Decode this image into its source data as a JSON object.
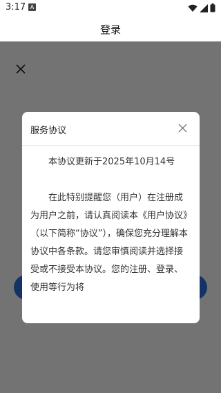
{
  "status_bar": {
    "time": "3:17",
    "notification_badge": "A"
  },
  "header": {
    "title": "登录"
  },
  "dialog": {
    "title": "服务协议",
    "paragraphs": [
      "本协议更新于2025年10月14号",
      "在此特别提醒您（用户）在注册成为用户之前，请认真阅读本《用户协议》（以下简称“协议”），确保您充分理解本协议中各条款。请您审慎阅读并选择接受或不接受本协议。您的注册、登录、使用等行为将"
    ]
  },
  "colors": {
    "overlay": "rgba(0,0,0,0.55)",
    "primary_button": "#2f6fe0",
    "link": "#4d6fb8"
  },
  "icons": {
    "wifi": "wifi-icon",
    "signal": "signal-icon",
    "battery": "battery-icon",
    "close": "close-icon"
  }
}
